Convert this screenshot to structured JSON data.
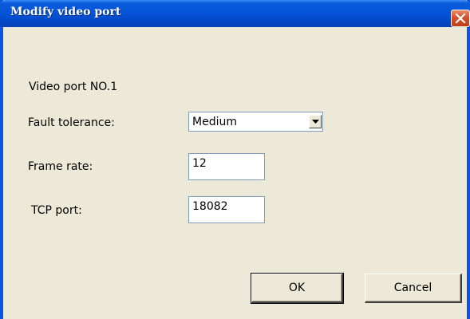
{
  "window": {
    "title": "Modify video port"
  },
  "icons": {
    "close": "close-icon",
    "dropdown": "chevron-down-icon"
  },
  "form": {
    "port_heading": "Video port NO.1",
    "fault_tolerance_label": "Fault tolerance:",
    "fault_tolerance_value": "Medium",
    "frame_rate_label": "Frame rate:",
    "frame_rate_value": "12",
    "tcp_port_label": "TCP port:",
    "tcp_port_value": "18082"
  },
  "buttons": {
    "ok_label": "OK",
    "cancel_label": "Cancel"
  },
  "colors": {
    "titlebar": "#0553d8",
    "close_button": "#d5502b",
    "window_background": "#ece9d8"
  }
}
